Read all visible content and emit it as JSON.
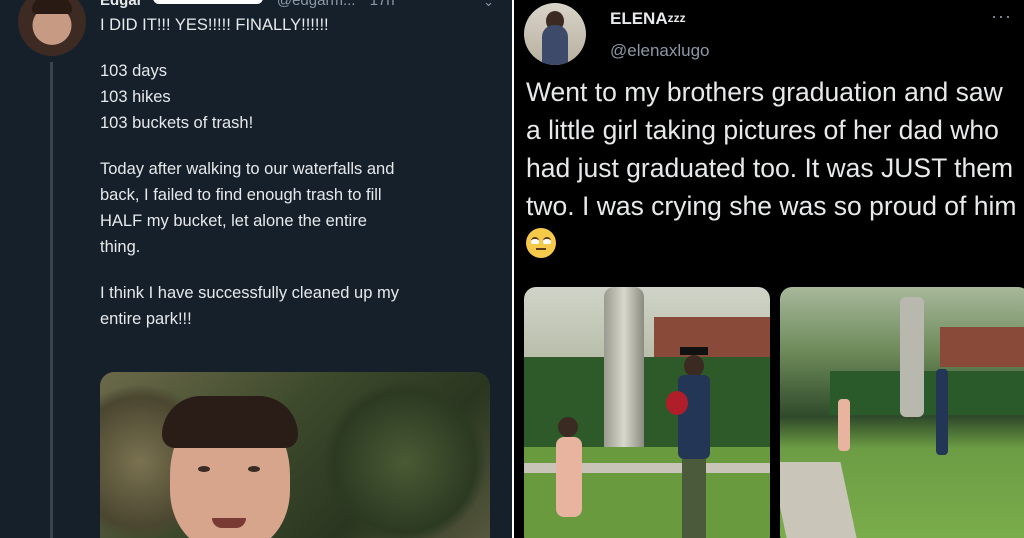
{
  "left_tweet": {
    "name": "Edgar",
    "handle": "@edgarm...",
    "timestamp": "17h",
    "lines": [
      "I DID IT!!! YES!!!!! FINALLY!!!!!!",
      "103 days",
      "103 hikes",
      "103 buckets of trash!",
      "Today after walking to our waterfalls and",
      "back, I failed to find enough trash to fill",
      "HALF my bucket, let alone the entire",
      "thing.",
      "I think I have successfully cleaned up my",
      "entire park!!!"
    ]
  },
  "right_tweet": {
    "name": "ELENA",
    "name_suffix": "zzz",
    "handle": "@elenaxlugo",
    "more": "···",
    "text": "Went to my brothers graduation and saw a little girl taking pictures of her dad who had just graduated too. It was JUST them two. I was crying she was so proud of him",
    "emoji": "face-with-rolling-eyes"
  },
  "colors": {
    "left_bg": "#15202b",
    "right_bg": "#000000",
    "text": "#e7e9ea",
    "muted": "#8b98a5"
  }
}
